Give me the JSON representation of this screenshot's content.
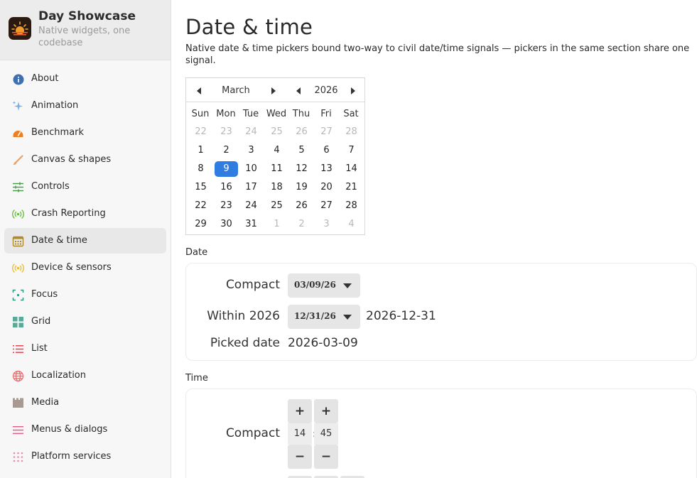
{
  "app": {
    "title": "Day Showcase",
    "subtitle": "Native widgets, one codebase"
  },
  "sidebar": {
    "items": [
      {
        "label": "About",
        "icon": "info-icon",
        "color": "#3e6fb0"
      },
      {
        "label": "Animation",
        "icon": "sparkles-icon",
        "color": "#7ab0e6"
      },
      {
        "label": "Benchmark",
        "icon": "gauge-icon",
        "color": "#f07d1e"
      },
      {
        "label": "Canvas & shapes",
        "icon": "brush-icon",
        "color": "#f0a05a"
      },
      {
        "label": "Controls",
        "icon": "sliders-icon",
        "color": "#4a9a4a"
      },
      {
        "label": "Crash Reporting",
        "icon": "broadcast-icon",
        "color": "#6cc04a"
      },
      {
        "label": "Date & time",
        "icon": "calendar-icon",
        "color": "#b08a2a",
        "active": true
      },
      {
        "label": "Device & sensors",
        "icon": "sensor-icon",
        "color": "#e6c03a"
      },
      {
        "label": "Focus",
        "icon": "focus-icon",
        "color": "#2a9a8a"
      },
      {
        "label": "Grid",
        "icon": "grid-icon",
        "color": "#5aaa9a"
      },
      {
        "label": "List",
        "icon": "list-icon",
        "color": "#e0505a"
      },
      {
        "label": "Localization",
        "icon": "globe-icon",
        "color": "#e87070"
      },
      {
        "label": "Media",
        "icon": "clapper-icon",
        "color": "#a89a90"
      },
      {
        "label": "Menus & dialogs",
        "icon": "menu-icon",
        "color": "#e0608a"
      },
      {
        "label": "Platform services",
        "icon": "dots-grid-icon",
        "color": "#e890a8"
      }
    ]
  },
  "page": {
    "title": "Date & time",
    "description": "Native date & time pickers bound two-way to civil date/time signals — pickers in the same section share one signal."
  },
  "calendar": {
    "month": "March",
    "year": "2026",
    "weekdays": [
      "Sun",
      "Mon",
      "Tue",
      "Wed",
      "Thu",
      "Fri",
      "Sat"
    ],
    "weeks": [
      [
        "22",
        "23",
        "24",
        "25",
        "26",
        "27",
        "28"
      ],
      [
        "1",
        "2",
        "3",
        "4",
        "5",
        "6",
        "7"
      ],
      [
        "8",
        "9",
        "10",
        "11",
        "12",
        "13",
        "14"
      ],
      [
        "15",
        "16",
        "17",
        "18",
        "19",
        "20",
        "21"
      ],
      [
        "22",
        "23",
        "24",
        "25",
        "26",
        "27",
        "28"
      ],
      [
        "29",
        "30",
        "31",
        "1",
        "2",
        "3",
        "4"
      ]
    ],
    "selected_day": "9",
    "accent": "#2f7de1"
  },
  "date_section": {
    "label": "Date",
    "compact_label": "Compact",
    "compact_value": "03/09/26",
    "within_label": "Within 2026",
    "within_value": "12/31/26",
    "within_iso": "2026-12-31",
    "picked_label": "Picked date",
    "picked_value": "2026-03-09"
  },
  "time_section": {
    "label": "Time",
    "compact_label": "Compact",
    "hour": "14",
    "separator": ":",
    "minute": "45",
    "plus": "+",
    "minus": "−"
  }
}
